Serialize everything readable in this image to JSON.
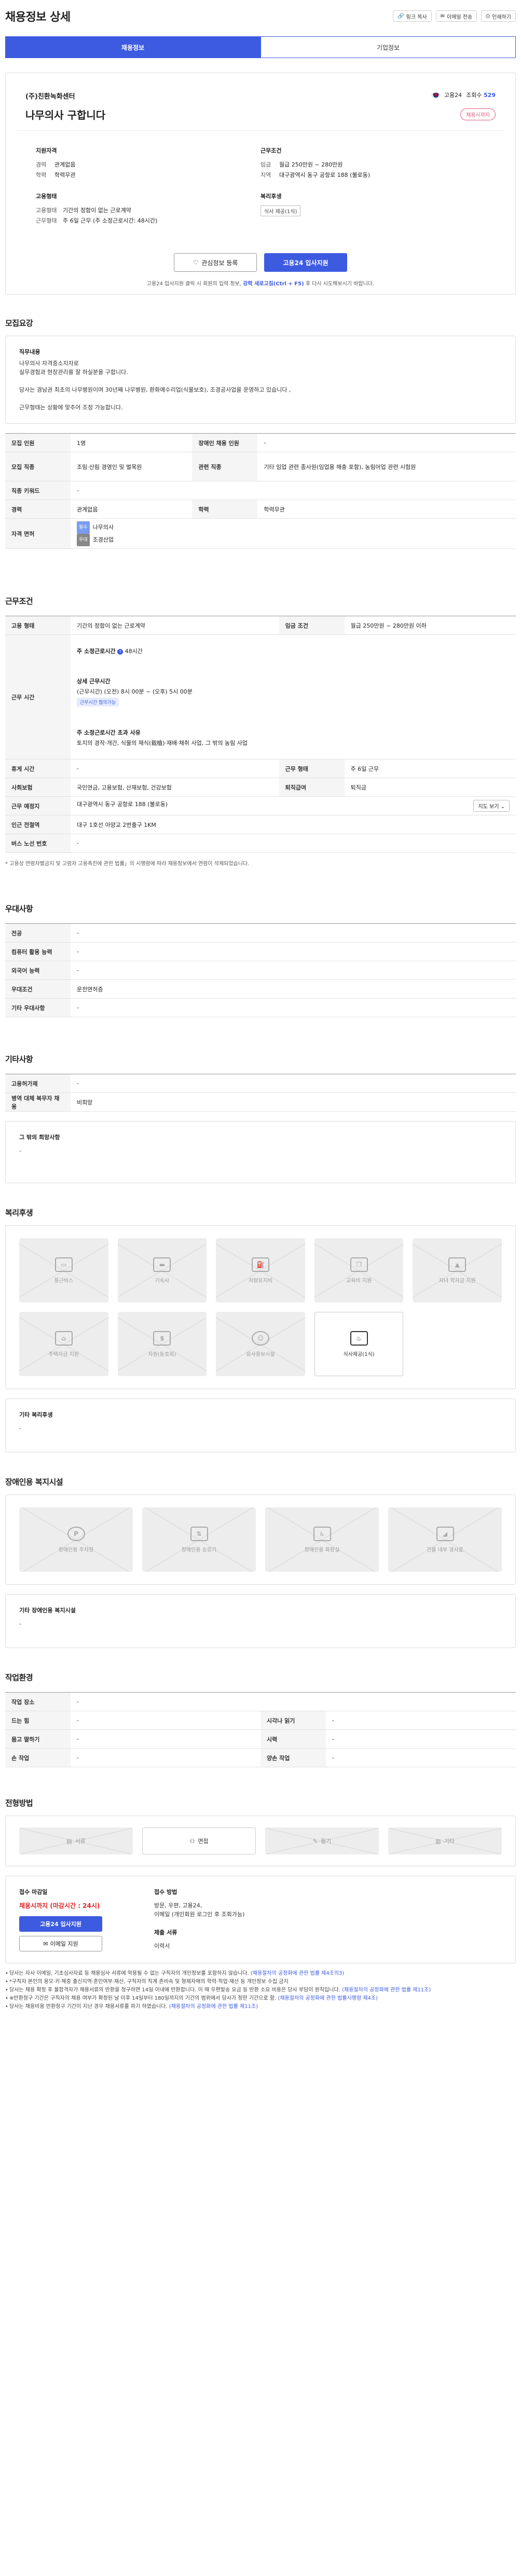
{
  "header": {
    "title": "채용정보 상세",
    "tools": [
      {
        "icon": "link-icon",
        "label": "링크 복사"
      },
      {
        "icon": "mail-icon",
        "label": "이메일 전송"
      },
      {
        "icon": "print-icon",
        "label": "인쇄하기"
      }
    ]
  },
  "tabs": [
    {
      "label": "채용정보",
      "active": true
    },
    {
      "label": "기업정보",
      "active": false
    }
  ],
  "job": {
    "company": "(주)친환녹화센터",
    "title": "나무의사 구합니다",
    "source": "고용24",
    "views_label": "조회수",
    "views": "529",
    "badge": "채용시까지"
  },
  "summary": {
    "qual_h": "지원자격",
    "exp_k": "경력",
    "exp_v": "관계없음",
    "edu_k": "학력",
    "edu_v": "학력무관",
    "cond_h": "근무조건",
    "wage_k": "임금",
    "wage_v": "월급 250만원 ~ 280만원",
    "loc_k": "지역",
    "loc_v": "대구광역시 동구 공항로 188 (불로동)",
    "emp_h": "고용형태",
    "emp_type_k": "고용형태",
    "emp_type_v": "기간의 정함이 없는 근로계약",
    "work_k": "근무형태",
    "work_v": "주 6일 근무 (주 소정근로시간: 48시간)",
    "welfare_h": "복리후생",
    "welfare_tag": "식사 제공(1식)"
  },
  "actions": {
    "interest": "관심정보 등록",
    "apply": "고용24 입사지원",
    "notice_pre": "고용24 입사지원 클릭 시 회원의 입력 정보,",
    "notice_key": "강력 새로고침(Ctrl + F5)",
    "notice_post": "후 다시 시도해보시기 바랍니다."
  },
  "recruit": {
    "title": "모집요강",
    "duty_h": "직무내용",
    "duty_lines": [
      "나무의사 자격증소지자로",
      "실무경험과 현장관리를 잘 하실분을 구합니다.",
      "",
      "당사는 경남권 최초의 나무병원이며 30년째 나무병원, 환화예수리업(식물보호), 조경공사업을 운영하고 있습니다 ,",
      "",
      "근무형태는 상황에 맞추어 조정 가능합니다."
    ],
    "rows": [
      {
        "k1": "모집 인원",
        "v1": "1명",
        "k2": "장애인 채용 인원",
        "v2": "-"
      },
      {
        "k1": "모집 직종",
        "v1": "조림·산림 경영인 및 벌목원",
        "k2": "관련 직종",
        "v2": "기타 임업 관련 종사원(임업용 해충 포함), 농림어업 관련 시험원"
      },
      {
        "k1": "직종 키워드",
        "v1": "-",
        "k2": "",
        "v2": ""
      },
      {
        "k1": "경력",
        "v1": "관계없음",
        "k2": "학력",
        "v2": "학력무관"
      }
    ],
    "license_k": "자격 면허",
    "licenses": [
      {
        "tag": "필수",
        "name": "나무의사"
      },
      {
        "tag": "우대",
        "name": "조경산업"
      }
    ]
  },
  "work": {
    "title": "근무조건",
    "emp_k": "고용 형태",
    "emp_v": "기간의 정함이 없는 근로계약",
    "wage_k": "임금 조건",
    "wage_v": "월급 250만원 ~ 280만원 이하",
    "time_k": "근무 시간",
    "weekly_label": "주 소정근로시간",
    "weekly_v": "48시간",
    "detail_label": "상세 근무시간",
    "detail_v": "(근무시간) (오전) 8시 00분 ~ (오후) 5시 00분",
    "detail_chip": "근무시간 협의가능",
    "exceed_label": "주 소정근로시간 초과 사유",
    "exceed_v": "토지의 경작·개간, 식물의 재식(栽植)·재배·채취 사업, 그 밖의 농림 사업",
    "holiday_k": "휴게 시간",
    "holiday_v": "-",
    "workday_k": "근무 형태",
    "workday_v": "주 6일 근무",
    "ins_k": "사회보험",
    "ins_v": "국민연금, 고용보험, 산재보험, 건강보험",
    "retire_k": "퇴직급여",
    "retire_v": "퇴직금",
    "place_k": "근무 예정지",
    "place_v": "대구광역시 동구 공항로 188 (불로동)",
    "map_btn": "지도 보기",
    "subway_k": "인근 전철역",
    "subway_v": "대구 1호선 아양교 2번출구 1KM",
    "bus_k": "버스 노선 번호",
    "bus_v": "-",
    "footnote": "* 고용상 연령차별금지 및 고령자 고용촉진에 관한 법률」의 시행령에 따라 채용정보에서 연령이 삭제되었습니다."
  },
  "pref": {
    "title": "우대사항",
    "rows": [
      {
        "k": "전공",
        "v": "-"
      },
      {
        "k": "컴퓨터 활용 능력",
        "v": "-"
      },
      {
        "k": "외국어 능력",
        "v": "-"
      },
      {
        "k": "우대조건",
        "v": "운전면허증"
      },
      {
        "k": "기타 우대사항",
        "v": "-"
      }
    ]
  },
  "etc": {
    "title": "기타사항",
    "rows": [
      {
        "k": "고용허가제",
        "v": "-"
      },
      {
        "k": "병역 대체 복무자 채용",
        "v": "비희망"
      }
    ],
    "other_h": "그 밖의 희망사항",
    "other_v": "-"
  },
  "benefits": {
    "title": "복리후생",
    "items": [
      {
        "label": "통근버스",
        "icon": "bus-icon",
        "on": false
      },
      {
        "label": "기숙사",
        "icon": "bed-icon",
        "on": false
      },
      {
        "label": "차량유지비",
        "icon": "fuel-icon",
        "on": false
      },
      {
        "label": "교육비 지원",
        "icon": "book-icon",
        "on": false
      },
      {
        "label": "자녀 학자금 지원",
        "icon": "cap-icon",
        "on": false
      },
      {
        "label": "주택자금 지원",
        "icon": "house-icon",
        "on": false
      },
      {
        "label": "자원(동호회)",
        "icon": "money-icon",
        "on": false
      },
      {
        "label": "유사용보시설",
        "icon": "baby-icon",
        "on": false
      },
      {
        "label": "식사제공(1식)",
        "icon": "meal-icon",
        "on": true
      }
    ],
    "other_h": "기타 복리후생",
    "other_v": "-"
  },
  "disability": {
    "title": "장애인용 복지시설",
    "items": [
      {
        "label": "장애인용 주차장",
        "icon": "parking-icon"
      },
      {
        "label": "장애인용 승강기",
        "icon": "elevator-icon"
      },
      {
        "label": "장애인용 화장실",
        "icon": "restroom-icon"
      },
      {
        "label": "건물 내부 경사로",
        "icon": "ramp-icon"
      }
    ],
    "other_h": "기타 장애인용 복지시설",
    "other_v": "-"
  },
  "env": {
    "title": "작업환경",
    "rows": [
      {
        "k1": "작업 장소",
        "v1": "-",
        "k2": "",
        "v2": ""
      },
      {
        "k1": "드는 힘",
        "v1": "-",
        "k2": "시각나 읽기",
        "v2": "-"
      },
      {
        "k1": "몸고 딸하기",
        "v1": "-",
        "k2": "시력",
        "v2": "-"
      },
      {
        "k1": "손 작업",
        "v1": "-",
        "k2": "양손 작업",
        "v2": "-"
      }
    ]
  },
  "selection": {
    "title": "전형방법",
    "items": [
      {
        "label": "서류",
        "on": false
      },
      {
        "label": "면접",
        "on": true
      },
      {
        "label": "필기",
        "on": false
      },
      {
        "label": "기타",
        "on": false
      }
    ],
    "deadline_h": "접수 마감일",
    "deadline_v": "채용시까지 (마감시간 : 24시)",
    "apply_btn": "고용24 입사지원",
    "email_btn": "이메일 지원",
    "method_h": "접수 방법",
    "method_v1": "방문, 우편, 고용24,",
    "method_v2": "이메일 (개인회원 로그인 후 조회가능)",
    "docs_h": "제출 서류",
    "docs_v": "이력서"
  },
  "bullets": [
    {
      "text": "당사는 자사 이메일, 기초심사자료 등 채용심사 서류에 악용될 수 없는 구직자의 개인정보를 포함하지 않습니다.",
      "link": "(채용절차의 공정화에 관한 법률 제4조의3)"
    },
    {
      "text": "*구직자 본인의 용모·키·체중 출신지역·혼인여부·재산, 구직자의 직계 존비속 및 형제자매의 학력·직업·재산 등 개인정보 수집 금지",
      "link": ""
    },
    {
      "text": "당사는 채용 확정 후 불합격자가 채용서류의 반환을 청구하면 14일 이내에 반환합니다. 이 때 우편발송 요금 등 반환 소요 비용은 당사 부담이 원칙입니다.",
      "link": "(채용절차의 공정화에 관한 법률 제11조)"
    },
    {
      "text": "※반환청구 기간은 구직자의 채용 여부가 확정된 날 이후 14일부터 180일까지의 기간의 범위에서 당사가 정한 기간으로 함.",
      "link": "(채용절차의 공정화에 관한 법률시행령 제4조)"
    },
    {
      "text": "당사는 채용비용 반환청구 기간이 지난 경우 채용서류를 파기 하였습니다.",
      "link": "(채용절차의 공정화에 관한 법률 제11조)"
    }
  ]
}
